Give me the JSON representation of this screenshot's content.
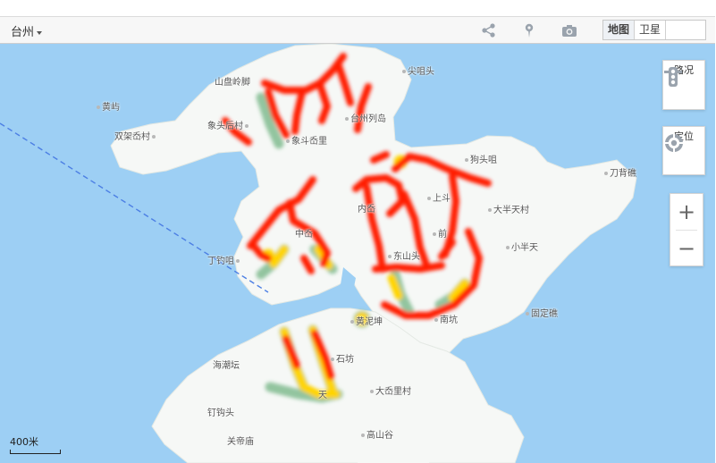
{
  "toolbar": {
    "city": "台州",
    "tools": [
      {
        "icon": "share-icon"
      },
      {
        "icon": "map-pin-icon"
      },
      {
        "icon": "camera-icon"
      }
    ],
    "map_types": [
      {
        "label": "地图",
        "active": true
      },
      {
        "label": "卫星",
        "active": false
      },
      {
        "label": "",
        "active": false
      }
    ]
  },
  "controls": {
    "traffic": {
      "label": "路况",
      "icon": "traffic-light-icon"
    },
    "locate": {
      "label": "定位",
      "icon": "locate-icon"
    },
    "zoom_in": "+",
    "zoom_out": "−"
  },
  "scale": {
    "label": "400米"
  },
  "colors": {
    "water": "#9dcff4",
    "land": "#f6f8f6",
    "heat_high": "#ff1a00",
    "heat_mid": "#ffd400",
    "heat_low": "#7ab88a"
  },
  "places": [
    {
      "name": "山盘岭脚"
    },
    {
      "name": "尖咀头"
    },
    {
      "name": "黄屿"
    },
    {
      "name": "双架岙村"
    },
    {
      "name": "象头后村"
    },
    {
      "name": "台州列岛"
    },
    {
      "name": "象斗岙里"
    },
    {
      "name": "狗头咀"
    },
    {
      "name": "刀背礁"
    },
    {
      "name": "大半天村"
    },
    {
      "name": "上斗"
    },
    {
      "name": "内岙"
    },
    {
      "name": "中岙"
    },
    {
      "name": "前"
    },
    {
      "name": "东山头"
    },
    {
      "name": "小半天"
    },
    {
      "name": "丁钓咀"
    },
    {
      "name": "固定礁"
    },
    {
      "name": "南坑"
    },
    {
      "name": "黄泥坤"
    },
    {
      "name": "海潮坛"
    },
    {
      "name": "石坊"
    },
    {
      "name": "大岙里村"
    },
    {
      "name": "钉钩头"
    },
    {
      "name": "关帝庙"
    },
    {
      "name": "高山谷"
    },
    {
      "name": "天"
    }
  ]
}
